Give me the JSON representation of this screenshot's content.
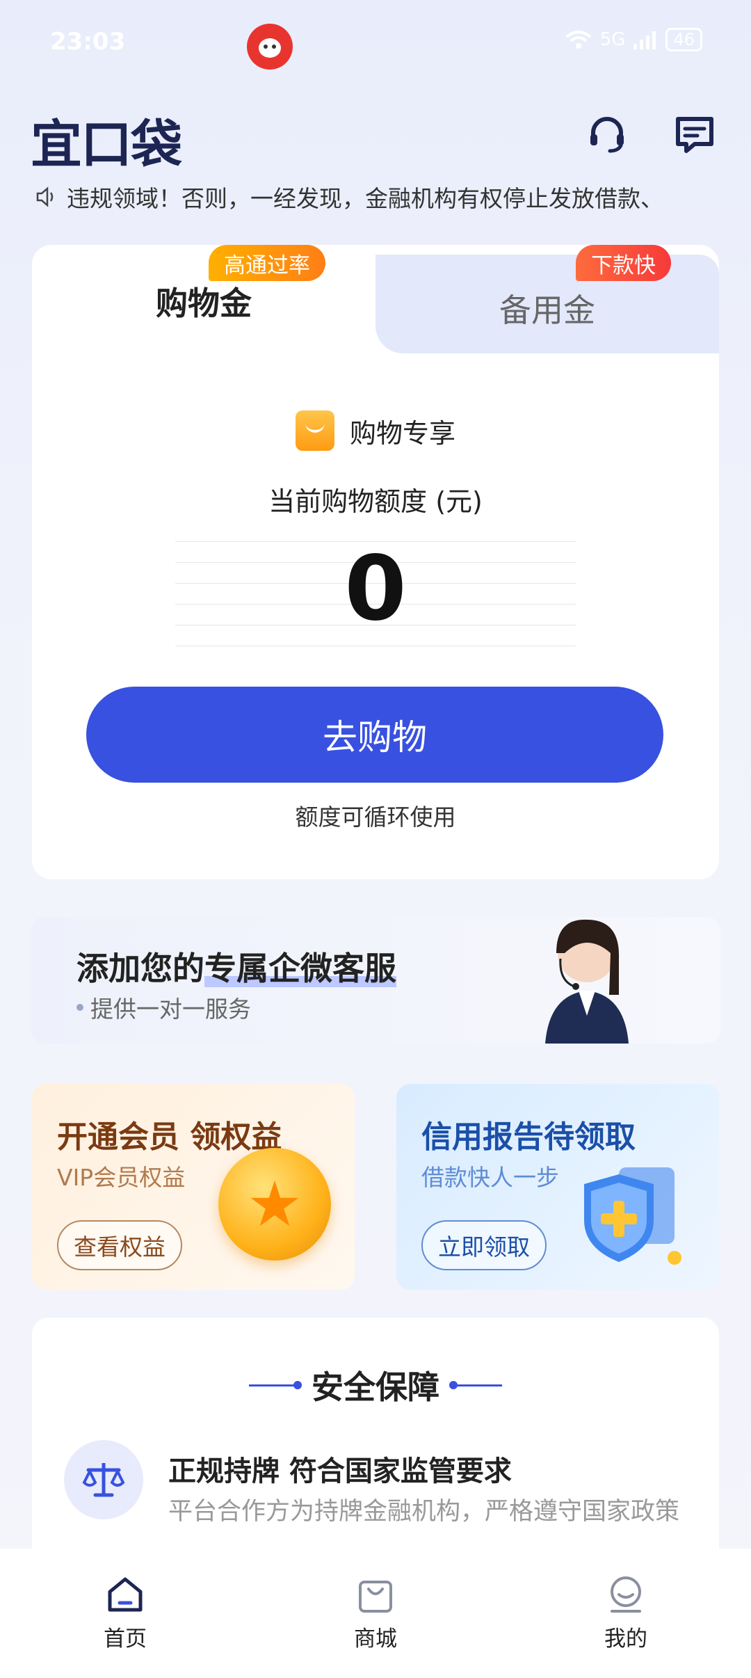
{
  "status_bar": {
    "time": "23:03",
    "network": "5G",
    "battery": "46"
  },
  "header": {
    "logo": "宜口袋"
  },
  "marquee": {
    "text": "违规领域！否则，一经发现，金融机构有权停止发放借款、"
  },
  "card": {
    "tab_left": "购物金",
    "tab_right": "备用金",
    "badge_left": "高通过率",
    "badge_right": "下款快",
    "shop_label": "购物专享",
    "quota_label": "当前购物额度 (元)",
    "amount": "0",
    "button": "去购物",
    "note": "额度可循环使用"
  },
  "service": {
    "title_prefix": "添加您的",
    "title_highlight": "专属企微客服",
    "subtitle": "提供一对一服务"
  },
  "promo_vip": {
    "title": "开通会员 领权益",
    "subtitle": "VIP会员权益",
    "button": "查看权益"
  },
  "promo_credit": {
    "title": "信用报告待领取",
    "subtitle": "借款快人一步",
    "button": "立即领取"
  },
  "safety": {
    "title": "安全保障",
    "heading": "正规持牌 符合国家监管要求",
    "text": "平台合作方为持牌金融机构，严格遵守国家政策"
  },
  "nav": {
    "home": "首页",
    "mall": "商城",
    "mine": "我的"
  },
  "colors": {
    "primary": "#3851e0",
    "logo": "#1d2553",
    "badge_orange": "#ff9a0a",
    "badge_red": "#f54a3a"
  }
}
